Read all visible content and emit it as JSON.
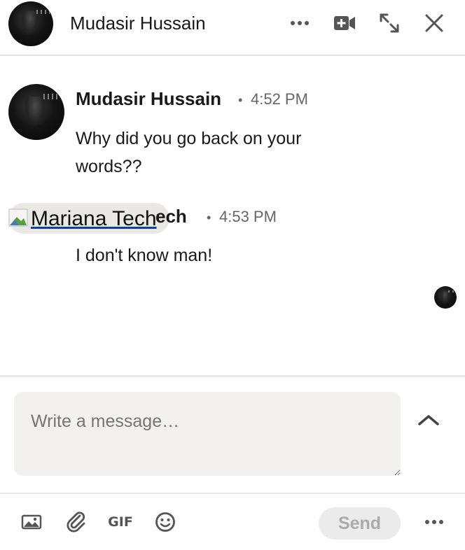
{
  "header": {
    "name": "Mudasir Hussain"
  },
  "messages": [
    {
      "sender": "Mudasir Hussain",
      "separator": "•",
      "time": "4:52 PM",
      "text_line1": "Why did you go back on your",
      "text_line2": "words??"
    },
    {
      "sender_image_alt": "Mariana Tech",
      "sender_suffix": "ech",
      "separator": "•",
      "time": "4:53 PM",
      "text": "I don't know man!"
    }
  ],
  "compose": {
    "placeholder": "Write a message…"
  },
  "toolbar": {
    "gif_label": "GIF",
    "send_label": "Send"
  },
  "icons": {
    "more": "more-horizontal-icon",
    "video": "video-call-icon",
    "expand": "expand-icon",
    "close": "close-icon",
    "image": "image-icon",
    "attach": "paperclip-icon",
    "emoji": "emoji-icon",
    "collapse": "chevron-up-icon"
  }
}
